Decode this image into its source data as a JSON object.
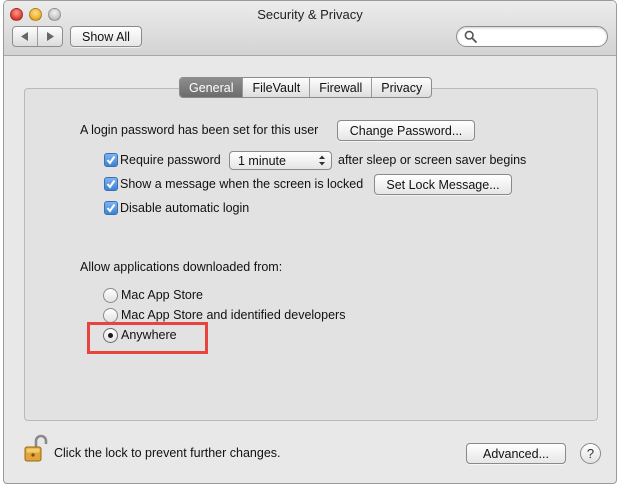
{
  "window": {
    "title": "Security & Privacy",
    "show_all_label": "Show All",
    "search_placeholder": ""
  },
  "tabs": [
    {
      "label": "General",
      "active": true
    },
    {
      "label": "FileVault",
      "active": false
    },
    {
      "label": "Firewall",
      "active": false
    },
    {
      "label": "Privacy",
      "active": false
    }
  ],
  "general": {
    "password_text": "A login password has been set for this user",
    "change_password_label": "Change Password...",
    "require_password": {
      "label": "Require password",
      "checked": true
    },
    "password_delay": "1 minute",
    "after_sleep_text": "after sleep or screen saver begins",
    "show_message": {
      "label": "Show a message when the screen is locked",
      "checked": true
    },
    "set_lock_message_label": "Set Lock Message...",
    "disable_autologin": {
      "label": "Disable automatic login",
      "checked": true
    },
    "allow_apps_heading": "Allow applications downloaded from:",
    "radio_options": [
      {
        "label": "Mac App Store",
        "selected": false
      },
      {
        "label": "Mac App Store and identified developers",
        "selected": false
      },
      {
        "label": "Anywhere",
        "selected": true
      }
    ]
  },
  "footer": {
    "lock_text": "Click the lock to prevent further changes.",
    "advanced_label": "Advanced...",
    "help_label": "?"
  },
  "colors": {
    "highlight": "#e8443f",
    "checkbox_blue": "#3d83d6"
  }
}
